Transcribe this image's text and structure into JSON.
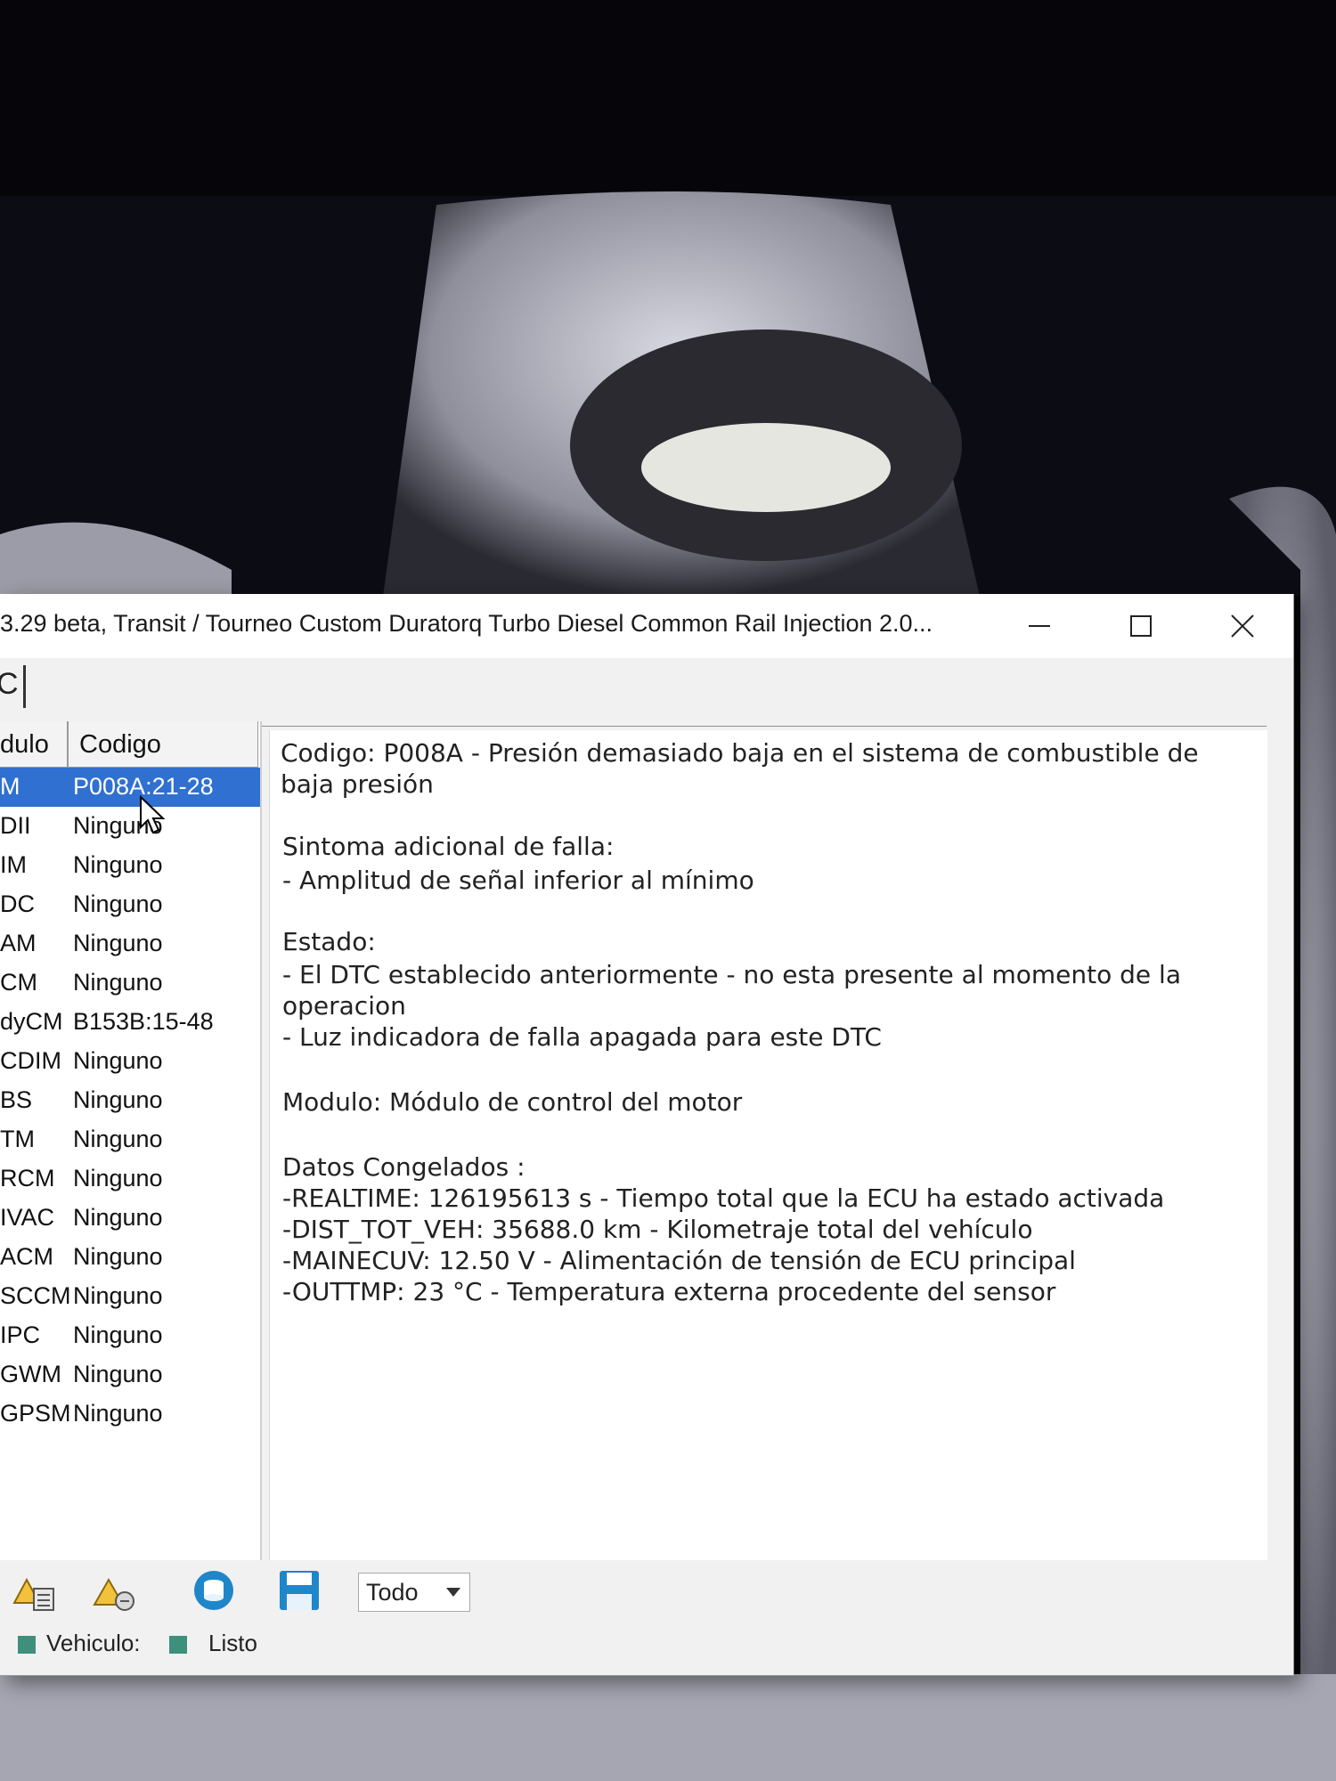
{
  "window": {
    "title": "3.29 beta, Transit / Tourneo Custom Duratorq Turbo Diesel Common Rail Injection 2.0...",
    "toolbar_letter": "C"
  },
  "table": {
    "headers": {
      "module": "dulo",
      "code": "Codigo"
    },
    "rows": [
      {
        "module": "M",
        "code": "P008A:21-28",
        "selected": true
      },
      {
        "module": "DII",
        "code": "Ninguno"
      },
      {
        "module": "IM",
        "code": "Ninguno"
      },
      {
        "module": "DC",
        "code": "Ninguno"
      },
      {
        "module": "AM",
        "code": "Ninguno"
      },
      {
        "module": "CM",
        "code": "Ninguno"
      },
      {
        "module": "dyCM",
        "code": "B153B:15-48"
      },
      {
        "module": "CDIM",
        "code": "Ninguno"
      },
      {
        "module": "BS",
        "code": "Ninguno"
      },
      {
        "module": "TM",
        "code": "Ninguno"
      },
      {
        "module": "RCM",
        "code": "Ninguno"
      },
      {
        "module": "IVAC",
        "code": "Ninguno"
      },
      {
        "module": "ACM",
        "code": "Ninguno"
      },
      {
        "module": "SCCM",
        "code": "Ninguno"
      },
      {
        "module": "IPC",
        "code": "Ninguno"
      },
      {
        "module": "GWM",
        "code": "Ninguno"
      },
      {
        "module": "GPSM",
        "code": "Ninguno"
      }
    ]
  },
  "detail": {
    "code_line_1": "Codigo: P008A - Presión demasiado baja en el sistema de combustible de",
    "code_line_2": "baja presión",
    "symptom_title": "Sintoma adicional de falla:",
    "symptom_1": " - Amplitud de señal inferior al mínimo",
    "status_title": "Estado:",
    "status_1a": " - El DTC establecido anteriormente - no esta presente al momento de la",
    "status_1b": "operacion",
    "status_2": " - Luz indicadora de falla apagada para este DTC",
    "module_line": "Modulo: Módulo de control del motor",
    "frozen_title": " Datos Congelados :",
    "frozen_1": "-REALTIME: 126195613 s - Tiempo total que la ECU ha estado activada",
    "frozen_2": "-DIST_TOT_VEH: 35688.0 km - Kilometraje total del vehículo",
    "frozen_3": "-MAINECUV: 12.50 V - Alimentación de tensión de ECU principal",
    "frozen_4": "-OUTTMP: 23 °C - Temperatura externa procedente del sensor"
  },
  "bottom_toolbar": {
    "filter_value": "Todo",
    "icons": [
      "warning-list-icon",
      "warning-clear-icon",
      "database-icon",
      "save-icon"
    ]
  },
  "status_bar": {
    "vehicle_label": "Vehiculo:",
    "ready_label": "Listo"
  },
  "colors": {
    "selection": "#3070d0",
    "status_indicator": "#3e8f7b",
    "accent_blue": "#1f86c9"
  }
}
